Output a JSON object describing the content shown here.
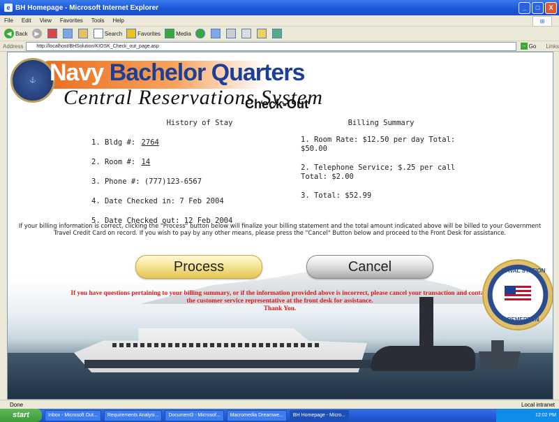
{
  "window": {
    "title": "BH Homepage - Microsoft Internet Explorer",
    "buttons": [
      "_",
      "□",
      "X"
    ]
  },
  "menu": [
    "File",
    "Edit",
    "View",
    "Favorites",
    "Tools",
    "Help"
  ],
  "toolbar": {
    "back": "Back",
    "search": "Search",
    "favorites": "Favorites",
    "media": "Media"
  },
  "address": {
    "label": "Address",
    "url": "http://localhost/BHSolution/KIOSK_Check_out_page.asp",
    "go": "Go",
    "links": "Links"
  },
  "banner": {
    "navy": "Navy",
    "rest": " Bachelor Quarters",
    "subtitle": "Central Reservations System",
    "page": "Check-Out"
  },
  "history": {
    "heading": "History of Stay",
    "bldg_label": "1.  Bldg #: ",
    "bldg": "2764",
    "room_label": "2. Room #: ",
    "room": "14",
    "phone": "3. Phone #:  (777)123-6567",
    "checkin": "4. Date Checked in: 7 Feb 2004",
    "checkout": "5. Date Checked out: 12 Feb 2004"
  },
  "billing": {
    "heading": "Billing Summary",
    "room_rate": "1. Room Rate: $12.50 per day   Total: $50.00",
    "telephone": "2. Telephone Service; $.25 per call Total:  $2.00",
    "total": "3. Total: $52.99"
  },
  "notice": "If your billing information is correct, clicking the \"Process\" button below will finalize your billing statement and the total amount indicated above will be billed to your Government Travel Credit Card on record. If you wish to pay by any other means, please press the \"Cancel\" Button below and proceed to the Front Desk for assistance.",
  "buttons": {
    "process": "Process",
    "cancel": "Cancel"
  },
  "warning": {
    "line1": "If you have questions pertaining to your billing summary, or if the information provided above is incorrect, please cancel your transaction and contact",
    "line2": "the customer service representative at the front desk for assistance.",
    "line3": "Thank You."
  },
  "seal": {
    "top": "NAVAL STATION",
    "bottom": "BREMERTON"
  },
  "status": {
    "left": "Done",
    "right": "Local intranet"
  },
  "taskbar": {
    "start": "start",
    "items": [
      "Inbox - Microsoft Out...",
      "Requirements Analysi...",
      "Document3 - Microsof...",
      "Macromedia Dreamwe...",
      "BH Homepage - Micro..."
    ],
    "clock": "12:02 PM"
  },
  "colors": {
    "warning": "#e01a1a",
    "navy_blue": "#1c3f94",
    "orange": "#e96a1b"
  }
}
